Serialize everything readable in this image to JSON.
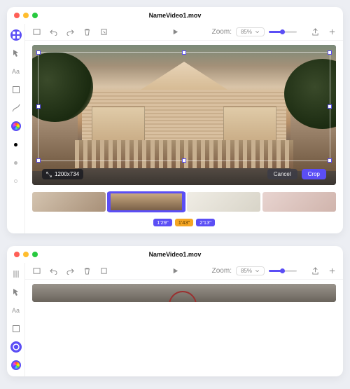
{
  "window": {
    "title": "NameVideo1.mov"
  },
  "zoom": {
    "label": "Zoom:",
    "value": "85%"
  },
  "crop": {
    "dimensions": "1200x734",
    "cancel_label": "Cancel",
    "crop_label": "Crop"
  },
  "timeline": {
    "markers": [
      "1'29\"",
      "1'43\"",
      "2'13\""
    ]
  },
  "sidebar_icons": [
    "grid",
    "cursor",
    "text",
    "rect",
    "pen",
    "color",
    "black-dot",
    "gray-dot",
    "white-dot"
  ],
  "toolbar_icons": [
    "aspect",
    "undo",
    "redo",
    "trash",
    "export",
    "play",
    "share",
    "add"
  ]
}
